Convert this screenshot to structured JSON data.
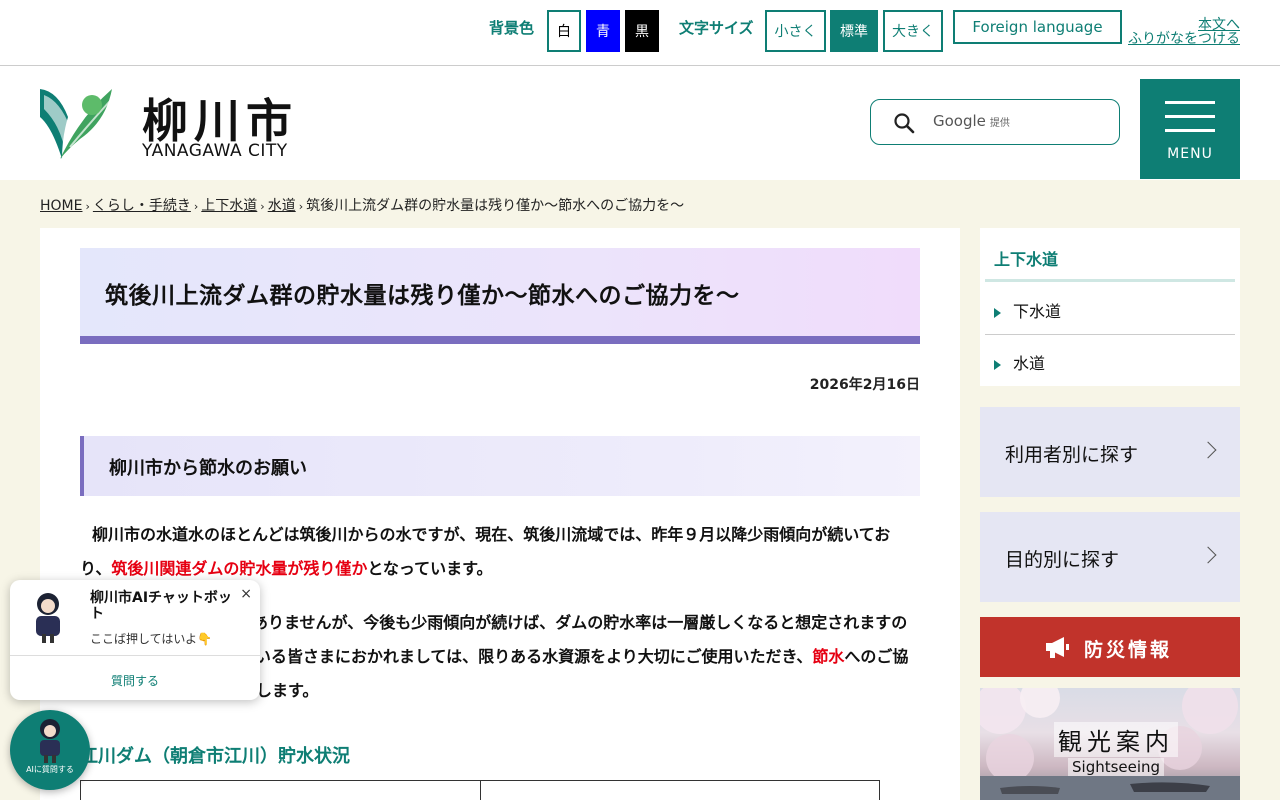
{
  "topbar": {
    "bg_label": "背景色",
    "bg_white": "白",
    "bg_blue": "青",
    "bg_black": "黒",
    "font_label": "文字サイズ",
    "font_small": "小さく",
    "font_standard": "標準",
    "font_large": "大きく",
    "foreign": "Foreign language",
    "skip_link": "本文へ",
    "furigana_link": "ふりがなをつける"
  },
  "header": {
    "logo_name": "柳川市",
    "logo_sub": "YANAGAWA CITY",
    "search_brand": "Google",
    "search_provided": "提供",
    "menu_label": "MENU"
  },
  "breadcrumb": {
    "items": [
      "HOME",
      "くらし・手続き",
      "上下水道",
      "水道"
    ],
    "current": "筑後川上流ダム群の貯水量は残り僅か～節水へのご協力を～",
    "separator": "›"
  },
  "article": {
    "title": "筑後川上流ダム群の貯水量は残り僅か～節水へのご協力を～",
    "date": "2026年2月16日",
    "section_heading": "柳川市から節水のお願い",
    "p1_before": "柳川市の水道水のほとんどは筑後川からの水ですが、現在、筑後川流域では、昨年９月以降少雨傾向が続いており、",
    "p1_highlight": "筑後川関連ダムの貯水量が残り僅か",
    "p1_after": "となっています。",
    "p2_before": "影響を及ぼすおそれはありませんが、今後も少雨傾向が続けば、ダムの貯水率は一層厳しくなると想定されますので、水道をご利用されている皆さまにおかれましては、限りある水資源をより大切にご使用いただき、",
    "p2_highlight": "節水",
    "p2_after": "へのご協力をよろしくお願いいたします。",
    "subheading": "江川ダム（朝倉市江川）貯水状況"
  },
  "sidebar": {
    "heading": "上下水道",
    "items": [
      "下水道",
      "水道"
    ],
    "find_by_user": "利用者別に探す",
    "find_by_purpose": "目的別に探す",
    "disaster": "防災情報",
    "tourism_title": "観光案内",
    "tourism_sub": "Sightseeing"
  },
  "chatbot": {
    "name": "柳川市AIチャットボット",
    "close": "×",
    "hint": "ここば押してはいよ👇",
    "ask": "質問する",
    "fab_label": "AIに質問する"
  },
  "colors": {
    "accent": "#0e7e74",
    "title_bar": "#7a6dbf",
    "alert_red": "#e60012",
    "disaster_red": "#c1332b",
    "content_bg": "#f7f5e7"
  }
}
